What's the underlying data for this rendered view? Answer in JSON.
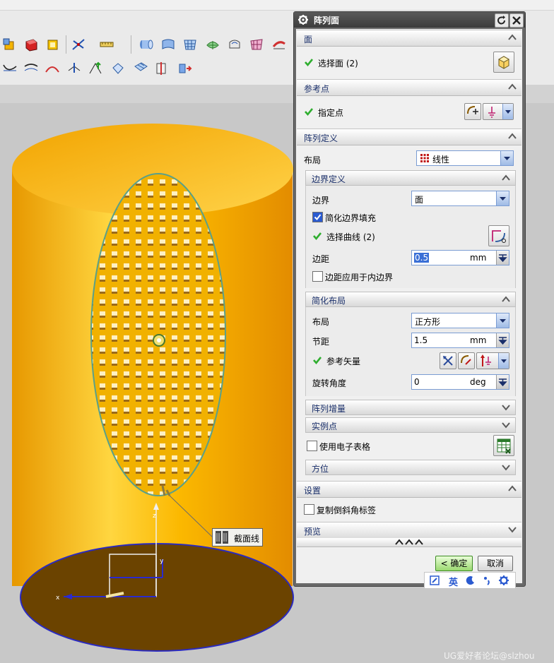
{
  "dialog": {
    "title": "阵列面",
    "groups": {
      "face": {
        "label": "面",
        "select_label": "选择面 (2)"
      },
      "refpoint": {
        "label": "参考点",
        "specify_label": "指定点"
      },
      "pattern_def": {
        "label": "阵列定义",
        "layout_label": "布局",
        "layout_value": "线性",
        "boundary_def": {
          "label": "边界定义",
          "boundary_label": "边界",
          "boundary_value": "面",
          "simplify_fill_label": "简化边界填充",
          "simplify_fill_checked": true,
          "select_curve_label": "选择曲线 (2)",
          "margin_label": "边距",
          "margin_value": "0.5",
          "margin_unit": "mm",
          "margin_inner_label": "边距应用于内边界",
          "margin_inner_checked": false
        },
        "simple_layout": {
          "label": "简化布局",
          "layout_label": "布局",
          "layout_value": "正方形",
          "pitch_label": "节距",
          "pitch_value": "1.5",
          "pitch_unit": "mm",
          "ref_vector_label": "参考矢量",
          "rotation_label": "旋转角度",
          "rotation_value": "0",
          "rotation_unit": "deg"
        },
        "increment_label": "阵列增量",
        "instance_label": "实例点",
        "spreadsheet_label": "使用电子表格",
        "spreadsheet_checked": false,
        "orientation_label": "方位"
      },
      "settings": {
        "label": "设置",
        "copy_chamfer_label": "复制倒斜角标签",
        "copy_chamfer_checked": false
      },
      "preview": {
        "label": "预览"
      }
    },
    "ok_label": "< 确定 >",
    "cancel_label": "取消"
  },
  "viewport": {
    "callout_label": "截面线",
    "watermark": "UG爱好者论坛@slzhou"
  },
  "ime": {
    "lang_label": "英"
  },
  "colors": {
    "cylinder": "#f5a800",
    "base": "#6b4300",
    "title_bar": "#3c3c3c",
    "group_header_text": "#1a2f6a",
    "ok_button": "#9ad86f"
  }
}
